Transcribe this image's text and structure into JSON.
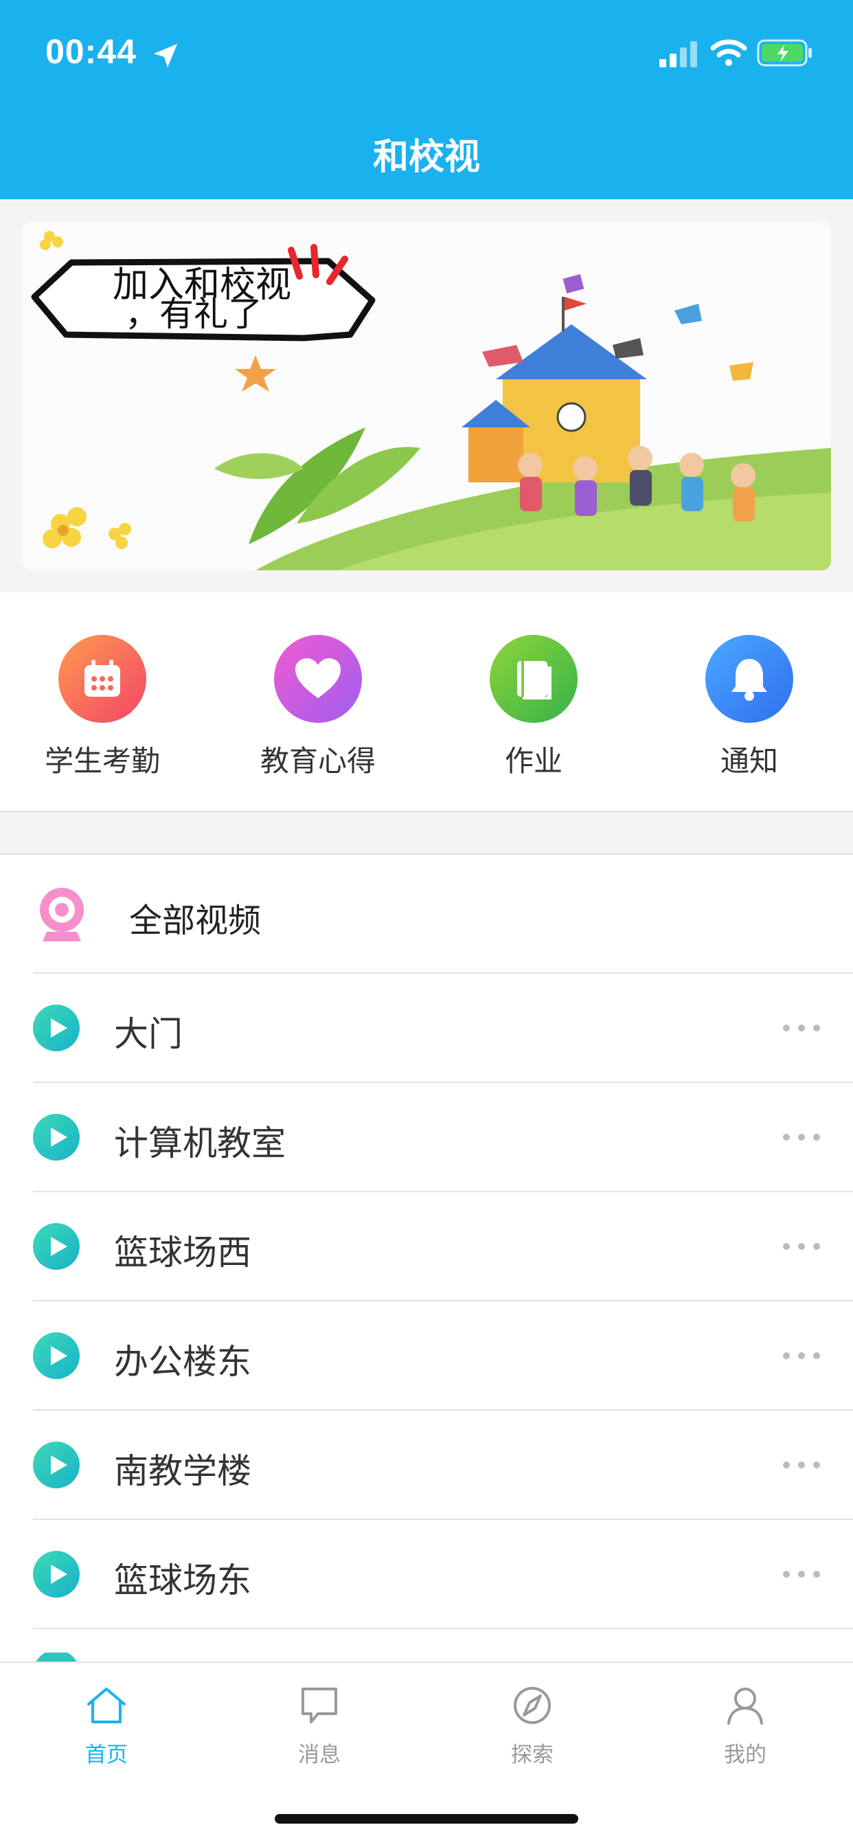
{
  "status_bar": {
    "time": "00:44"
  },
  "header": {
    "title": "和校视"
  },
  "banner": {
    "headline_line1": "加入和校视",
    "headline_line2": "，有礼了"
  },
  "quick_actions": [
    {
      "label": "学生考勤",
      "icon": "calendar-icon",
      "color_from": "#ff9a4d",
      "color_to": "#f2456a"
    },
    {
      "label": "教育心得",
      "icon": "heart-icon",
      "color_from": "#f05bd0",
      "color_to": "#a05cf2"
    },
    {
      "label": "作业",
      "icon": "book-icon",
      "color_from": "#8fd43a",
      "color_to": "#35b24a"
    },
    {
      "label": "通知",
      "icon": "bell-icon",
      "color_from": "#4aa8ff",
      "color_to": "#2f6fef"
    }
  ],
  "video_list": {
    "all_label": "全部视频",
    "items": [
      {
        "label": "大门"
      },
      {
        "label": "计算机教室"
      },
      {
        "label": "篮球场西"
      },
      {
        "label": "办公楼东"
      },
      {
        "label": "南教学楼"
      },
      {
        "label": "篮球场东"
      }
    ]
  },
  "tabbar": {
    "items": [
      {
        "label": "首页",
        "icon": "home-icon",
        "active": true
      },
      {
        "label": "消息",
        "icon": "message-icon",
        "active": false
      },
      {
        "label": "探索",
        "icon": "explore-icon",
        "active": false
      },
      {
        "label": "我的",
        "icon": "profile-icon",
        "active": false
      }
    ]
  },
  "colors": {
    "brand": "#1ab1ef",
    "play_from": "#3fd8b8",
    "play_to": "#16b3c8"
  }
}
